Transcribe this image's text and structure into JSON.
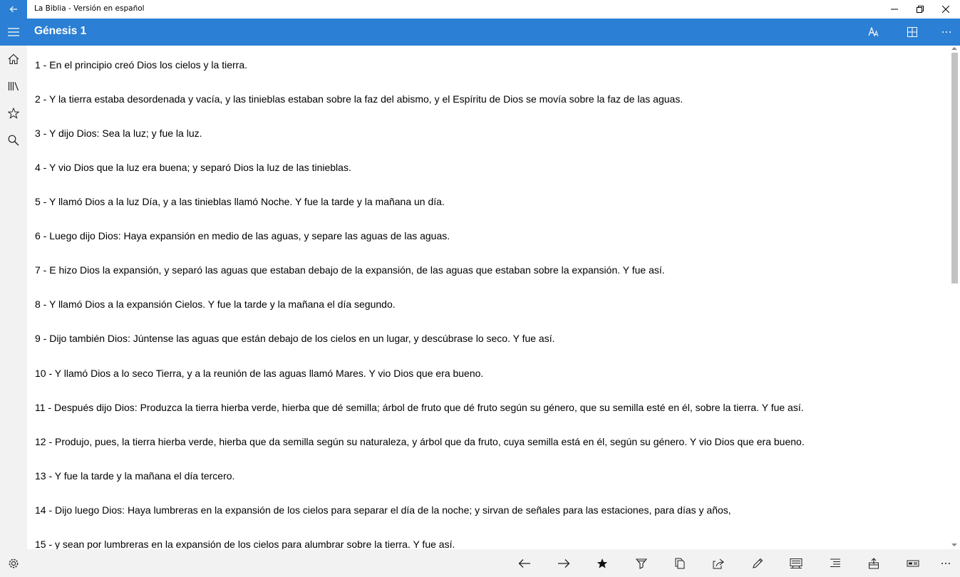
{
  "window": {
    "title": "La Biblia - Versión en español",
    "controls": [
      "minimize",
      "restore",
      "close"
    ]
  },
  "header": {
    "title": "Génesis 1",
    "color": "#2b7fd4",
    "actions": [
      "font-size-icon",
      "grid-icon",
      "more-icon"
    ]
  },
  "nav": {
    "items": [
      "home-icon",
      "library-icon",
      "favorites-icon",
      "search-icon"
    ],
    "bottom": "settings-icon"
  },
  "verses": [
    "1 - En el principio creó Dios los cielos y la tierra.",
    "2 - Y la tierra estaba desordenada y vacía, y las tinieblas estaban sobre la faz del abismo, y el Espíritu de Dios se movía sobre la faz de las aguas.",
    "3 - Y dijo Dios: Sea la luz; y fue la luz.",
    "4 - Y vio Dios que la luz era buena; y separó Dios la luz de las tinieblas.",
    "5 - Y llamó Dios a la luz Día, y a las tinieblas llamó Noche. Y fue la tarde y la mañana un día.",
    "6 - Luego dijo Dios: Haya expansión en medio de las aguas, y separe las aguas de las aguas.",
    "7 - E hizo Dios la expansión, y separó las aguas que estaban debajo de la expansión, de las aguas que estaban sobre la expansión. Y fue así.",
    "8 - Y llamó Dios a la expansión Cielos. Y fue la tarde y la mañana el día segundo.",
    "9 - Dijo también Dios: Júntense las aguas que están debajo de los cielos en un lugar, y descúbrase lo seco. Y fue así.",
    "10 - Y llamó Dios a lo seco Tierra, y a la reunión de las aguas llamó Mares. Y vio Dios que era bueno.",
    "11 - Después dijo Dios: Produzca la tierra hierba verde, hierba que dé semilla; árbol de fruto que dé fruto según su género, que su semilla esté en él, sobre la tierra. Y fue así.",
    "12 - Produjo, pues, la tierra hierba verde, hierba que da semilla según su naturaleza, y árbol que da fruto, cuya semilla está en él, según su género. Y vio Dios que era bueno.",
    "13 - Y fue la tarde y la mañana el día tercero.",
    "14 - Dijo luego Dios: Haya lumbreras en la expansión de los cielos para separar el día de la noche; y sirvan de señales para las estaciones, para días y años,",
    "15 - y sean por lumbreras en la expansión de los cielos para alumbrar sobre la tierra. Y fue así."
  ],
  "commandbar": {
    "items": [
      "previous-arrow-icon",
      "next-arrow-icon",
      "bookmark-star-icon",
      "highlight-icon",
      "copy-icon",
      "share-icon",
      "edit-note-icon",
      "compare-icon",
      "list-icon",
      "export-icon",
      "reading-mode-icon",
      "more-icon"
    ]
  }
}
